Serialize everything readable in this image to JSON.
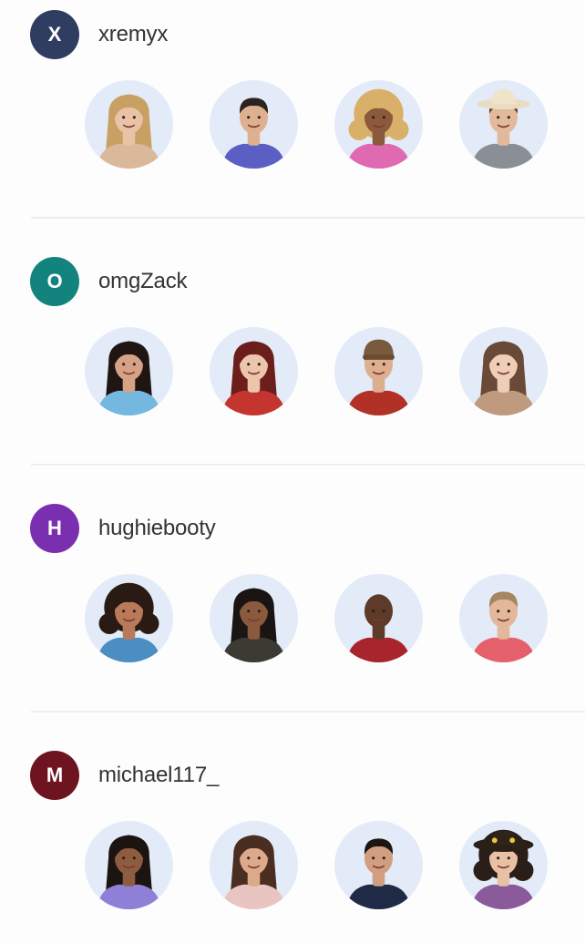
{
  "teams": [
    {
      "initial": "X",
      "username": "xremyx",
      "avatar_color": "#2e3d60",
      "picks": [
        {
          "skin": "#e9c3a6",
          "hair": "#c9a063",
          "hair_style": "long",
          "shirt": "#d9b99a",
          "hat": ""
        },
        {
          "skin": "#dfb08f",
          "hair": "#2b2320",
          "hair_style": "short",
          "shirt": "#5b5fc4",
          "hat": ""
        },
        {
          "skin": "#8b5a3c",
          "hair": "#d8b06a",
          "hair_style": "curly",
          "shirt": "#e06ab2",
          "hat": ""
        },
        {
          "skin": "#e3b99c",
          "hair": "#5a3d2c",
          "hair_style": "short",
          "shirt": "#8a8f95",
          "hat": "cowboy"
        }
      ]
    },
    {
      "initial": "O",
      "username": "omgZack",
      "avatar_color": "#13837e",
      "picks": [
        {
          "skin": "#d6a184",
          "hair": "#1f1613",
          "hair_style": "long",
          "shirt": "#74b8e0",
          "hat": ""
        },
        {
          "skin": "#ecc5ad",
          "hair": "#6b1e1b",
          "hair_style": "long",
          "shirt": "#c5352f",
          "hat": ""
        },
        {
          "skin": "#deae90",
          "hair": "#3a2a22",
          "hair_style": "short",
          "shirt": "#b23126",
          "hat": "beanie"
        },
        {
          "skin": "#efcdb6",
          "hair": "#6a4a36",
          "hair_style": "long",
          "shirt": "#c09a7e",
          "hat": ""
        }
      ]
    },
    {
      "initial": "H",
      "username": "hughiebooty",
      "avatar_color": "#7a2fb0",
      "picks": [
        {
          "skin": "#b87a58",
          "hair": "#2a1a14",
          "hair_style": "curly",
          "shirt": "#4c8ec2",
          "hat": ""
        },
        {
          "skin": "#8a5a3e",
          "hair": "#1a1412",
          "hair_style": "long",
          "shirt": "#3b3b34",
          "hat": ""
        },
        {
          "skin": "#5e3a28",
          "hair": "#1a1210",
          "hair_style": "bald",
          "shirt": "#a8252d",
          "hat": ""
        },
        {
          "skin": "#e4b69a",
          "hair": "#a58660",
          "hair_style": "short",
          "shirt": "#e4616c",
          "hat": ""
        }
      ]
    },
    {
      "initial": "M",
      "username": "michael117_",
      "avatar_color": "#6e1420",
      "picks": [
        {
          "skin": "#8e5c40",
          "hair": "#1c1411",
          "hair_style": "long",
          "shirt": "#8f7fd6",
          "hat": ""
        },
        {
          "skin": "#dcaa8a",
          "hair": "#4a2e22",
          "hair_style": "long",
          "shirt": "#e9c5c2",
          "hat": ""
        },
        {
          "skin": "#d19f80",
          "hair": "#1c1612",
          "hair_style": "short",
          "shirt": "#1e2a46",
          "hat": ""
        },
        {
          "skin": "#e8c0a6",
          "hair": "#2b1d18",
          "hair_style": "curly",
          "shirt": "#8a5a9a",
          "hat": "sunhat"
        }
      ]
    }
  ]
}
